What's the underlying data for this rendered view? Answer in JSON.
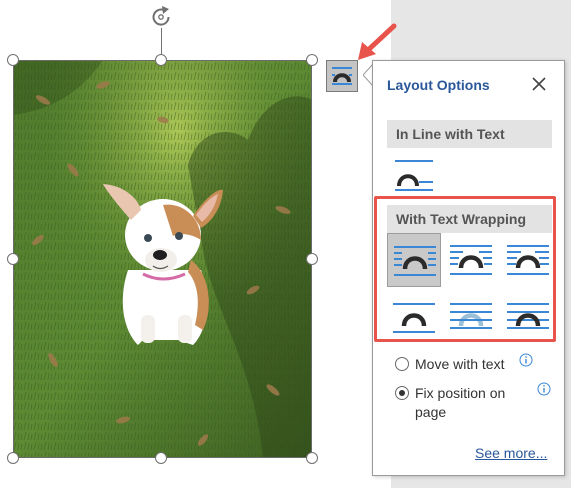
{
  "panel": {
    "title": "Layout Options",
    "sections": [
      {
        "heading": "In Line with Text"
      },
      {
        "heading": "With Text Wrapping"
      }
    ],
    "radios": [
      {
        "label": "Move with text",
        "checked": false
      },
      {
        "label": "Fix position on page",
        "checked": true
      }
    ],
    "see_more": "See more..."
  },
  "colors": {
    "accent_blue": "#2a579a",
    "line_blue": "#3a87d6",
    "highlight_red": "#e8534c"
  },
  "icons": {
    "layout_button": "layout-options-icon",
    "close": "close-icon",
    "info": "info-icon",
    "rotate": "rotate-icon"
  }
}
